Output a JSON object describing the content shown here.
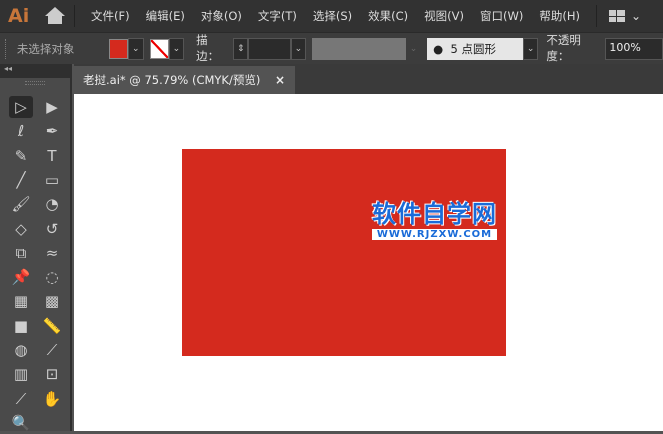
{
  "app": {
    "logo": "Ai"
  },
  "menu": [
    "文件(F)",
    "编辑(E)",
    "对象(O)",
    "文字(T)",
    "选择(S)",
    "效果(C)",
    "视图(V)",
    "窗口(W)",
    "帮助(H)"
  ],
  "control": {
    "selection_status": "未选择对象",
    "fill_color": "#d42a1e",
    "stroke_label": "描边：",
    "brush_size": "5",
    "brush_label": "点圆形",
    "opacity_label": "不透明度：",
    "opacity_value": "100%"
  },
  "document": {
    "tab_title": "老挝.ai* @ 75.79% (CMYK/预览)",
    "close": "×"
  },
  "panel": {
    "collapse": "◂◂"
  },
  "canvas": {
    "rect_color": "#d42a1e",
    "watermark_title": "软件自学网",
    "watermark_url": "WWW.RJZXW.COM"
  },
  "tools": [
    {
      "name": "selection-tool",
      "glyph": "▷"
    },
    {
      "name": "direct-selection-tool",
      "glyph": "▶"
    },
    {
      "name": "magic-wand-tool",
      "glyph": "ℓ"
    },
    {
      "name": "pen-tool",
      "glyph": "✒"
    },
    {
      "name": "curvature-tool",
      "glyph": "✎"
    },
    {
      "name": "type-tool",
      "glyph": "T"
    },
    {
      "name": "line-tool",
      "glyph": "╱"
    },
    {
      "name": "rectangle-tool",
      "glyph": "▭"
    },
    {
      "name": "paintbrush-tool",
      "glyph": "🖌"
    },
    {
      "name": "blob-brush-tool",
      "glyph": "◔"
    },
    {
      "name": "eraser-tool",
      "glyph": "◇"
    },
    {
      "name": "rotate-tool",
      "glyph": "↺"
    },
    {
      "name": "scale-tool",
      "glyph": "⧉"
    },
    {
      "name": "warp-tool",
      "glyph": "≈"
    },
    {
      "name": "puppet-warp-tool",
      "glyph": "📌"
    },
    {
      "name": "shape-builder-tool",
      "glyph": "◌"
    },
    {
      "name": "perspective-grid-tool",
      "glyph": "▦"
    },
    {
      "name": "mesh-tool",
      "glyph": "▩"
    },
    {
      "name": "gradient-tool",
      "glyph": "■"
    },
    {
      "name": "measure-tool",
      "glyph": "📏"
    },
    {
      "name": "blend-tool",
      "glyph": "◍"
    },
    {
      "name": "eyedropper-tool",
      "glyph": "⟋"
    },
    {
      "name": "column-graph-tool",
      "glyph": "▥"
    },
    {
      "name": "artboard-tool",
      "glyph": "⊡"
    },
    {
      "name": "slice-tool",
      "glyph": "⟋"
    },
    {
      "name": "hand-tool",
      "glyph": "✋"
    },
    {
      "name": "zoom-tool",
      "glyph": "🔍"
    }
  ]
}
